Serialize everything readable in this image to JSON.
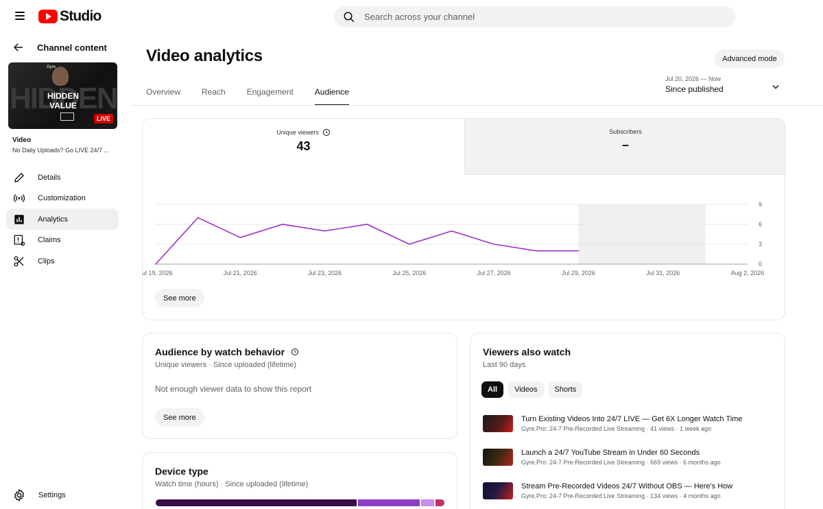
{
  "app": {
    "brand": "Studio"
  },
  "search": {
    "placeholder": "Search across your channel"
  },
  "sidebar": {
    "back_label": "Channel content",
    "thumbnail": {
      "bg_text": "HIDDEN",
      "overlay_title": "HIDDEN VALUE",
      "tag": "Gyre",
      "live_badge": "LIVE"
    },
    "video_label": "Video",
    "video_title": "No Daily Uploads? Go LIVE 24/7 ...",
    "items": [
      {
        "label": "Details",
        "icon": "pencil-icon"
      },
      {
        "label": "Customization",
        "icon": "broadcast-icon"
      },
      {
        "label": "Analytics",
        "icon": "analytics-icon",
        "active": true
      },
      {
        "label": "Claims",
        "icon": "claims-icon"
      },
      {
        "label": "Clips",
        "icon": "scissors-icon"
      }
    ],
    "settings_label": "Settings"
  },
  "header": {
    "title": "Video analytics",
    "advanced_mode": "Advanced mode",
    "tabs": [
      "Overview",
      "Reach",
      "Engagement",
      "Audience"
    ],
    "active_tab": "Audience",
    "date_range": "Jul 20, 2026 — Now",
    "period": "Since published"
  },
  "metrics": [
    {
      "label": "Unique viewers",
      "value": "43"
    },
    {
      "label": "Subscribers",
      "value": "–"
    }
  ],
  "chart_data": {
    "type": "line",
    "x": [
      "Jul 19, 2026",
      "Jul 20, 2026",
      "Jul 21, 2026",
      "Jul 22, 2026",
      "Jul 23, 2026",
      "Jul 24, 2026",
      "Jul 25, 2026",
      "Jul 26, 2026",
      "Jul 27, 2026",
      "Jul 28, 2026",
      "Jul 29, 2026"
    ],
    "values": [
      0,
      7,
      4,
      6,
      5,
      6,
      3,
      5,
      3,
      2,
      2
    ],
    "x_tick_labels": [
      "Jul 19, 2026",
      "Jul 21, 2026",
      "Jul 23, 2026",
      "Jul 25, 2026",
      "Jul 27, 2026",
      "Jul 29, 2026",
      "Jul 31, 2026",
      "Aug 2, 2026"
    ],
    "y_ticks": [
      0,
      3,
      6,
      9
    ],
    "ylim": [
      0,
      9
    ],
    "xrange": [
      "Jul 19, 2026",
      "Aug 2, 2026"
    ],
    "shaded_region": [
      "Jul 29, 2026",
      "Aug 1, 2026"
    ],
    "line_color": "#9b30c8",
    "grid": true
  },
  "metrics_see_more": "See more",
  "watch_behavior": {
    "title": "Audience by watch behavior",
    "subtitle": "Unique viewers · Since uploaded (lifetime)",
    "empty": "Not enough viewer data to show this report",
    "see_more": "See more"
  },
  "device": {
    "title": "Device type",
    "subtitle": "Watch time (hours) · Since uploaded (lifetime)",
    "segments": [
      {
        "share": 0.7,
        "color": "#3b0c4a"
      },
      {
        "share": 0.22,
        "color": "#8d3cc4"
      },
      {
        "share": 0.05,
        "color": "#c78df0"
      },
      {
        "share": 0.03,
        "color": "#c2306a"
      }
    ]
  },
  "also_watch": {
    "title": "Viewers also watch",
    "subtitle": "Last 90 days",
    "chips": [
      "All",
      "Videos",
      "Shorts"
    ],
    "videos": [
      {
        "title": "Turn Existing Videos Into 24/7 LIVE — Get 6X Longer Watch Time",
        "meta": "Gyre.Pro: 24-7 Pre-Recorded Live Streaming · 41 views · 1 week ago"
      },
      {
        "title": "Launch a 24/7 YouTube Stream in Under 60 Seconds",
        "meta": "Gyre.Pro: 24-7 Pre-Recorded Live Streaming · 669 views · 6 months ago"
      },
      {
        "title": "Stream Pre-Recorded Videos 24/7 Without OBS — Here's How",
        "meta": "Gyre.Pro: 24-7 Pre-Recorded Live Streaming · 134 views · 4 months ago"
      }
    ]
  }
}
